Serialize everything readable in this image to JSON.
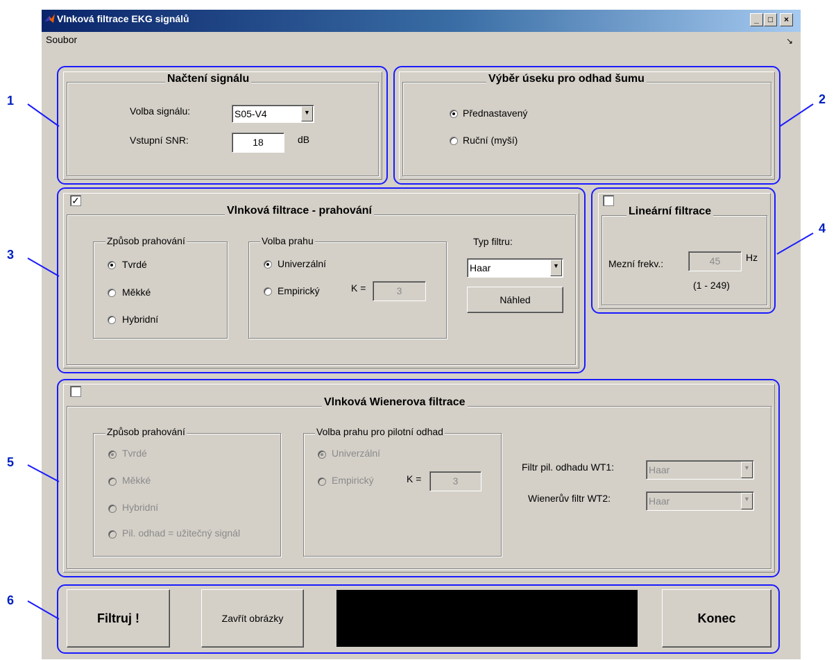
{
  "window": {
    "title": "Vlnková filtrace EKG signálů",
    "controls": {
      "minimize": "_",
      "maximize": "□",
      "close": "×"
    }
  },
  "menu": {
    "items": [
      "Soubor"
    ],
    "dock_icon": "↘"
  },
  "annotations": [
    "1",
    "2",
    "3",
    "4",
    "5",
    "6"
  ],
  "panel1": {
    "title": "Načtení signálu",
    "signal_label": "Volba signálu:",
    "signal_value": "S05-V4",
    "snr_label": "Vstupní SNR:",
    "snr_value": "18",
    "snr_unit": "dB"
  },
  "panel2": {
    "title": "Výběr úseku pro odhad šumu",
    "options": [
      {
        "label": "Přednastavený",
        "selected": true
      },
      {
        "label": "Ruční (myší)",
        "selected": false
      }
    ]
  },
  "panel3": {
    "enabled": true,
    "title": "Vlnková filtrace - prahování",
    "method_group": "Způsob prahování",
    "methods": [
      {
        "label": "Tvrdé",
        "selected": true
      },
      {
        "label": "Měkké",
        "selected": false
      },
      {
        "label": "Hybridní",
        "selected": false
      }
    ],
    "threshold_group": "Volba prahu",
    "thresholds": [
      {
        "label": "Univerzální",
        "selected": true
      },
      {
        "label": "Empirický",
        "selected": false
      }
    ],
    "k_label": "K =",
    "k_value": "3",
    "filter_type_label": "Typ filtru:",
    "filter_type_value": "Haar",
    "preview_button": "Náhled"
  },
  "panel4": {
    "enabled": false,
    "title": "Lineární filtrace",
    "cutoff_label": "Mezní frekv.:",
    "cutoff_value": "45",
    "cutoff_unit": "Hz",
    "range": "(1 - 249)"
  },
  "panel5": {
    "enabled": false,
    "title": "Vlnková Wienerova filtrace",
    "method_group": "Způsob prahování",
    "methods": [
      {
        "label": "Tvrdé",
        "selected": true
      },
      {
        "label": "Měkké",
        "selected": false
      },
      {
        "label": "Hybridní",
        "selected": false
      },
      {
        "label": "Pil. odhad = užitečný signál",
        "selected": false
      }
    ],
    "threshold_group": "Volba prahu pro pilotní odhad",
    "thresholds": [
      {
        "label": "Univerzální",
        "selected": true
      },
      {
        "label": "Empirický",
        "selected": false
      }
    ],
    "k_label": "K =",
    "k_value": "3",
    "wt1_label": "Filtr pil. odhadu WT1:",
    "wt1_value": "Haar",
    "wt2_label": "Wienerův filtr WT2:",
    "wt2_value": "Haar"
  },
  "panel6": {
    "filter_button": "Filtruj !",
    "close_figures_button": "Zavřít obrázky",
    "quit_button": "Konec",
    "display_color": "#000000"
  },
  "colors": {
    "annotation": "#1a1aff",
    "face": "#d4d0c8",
    "titlebar": "#0a246a"
  }
}
